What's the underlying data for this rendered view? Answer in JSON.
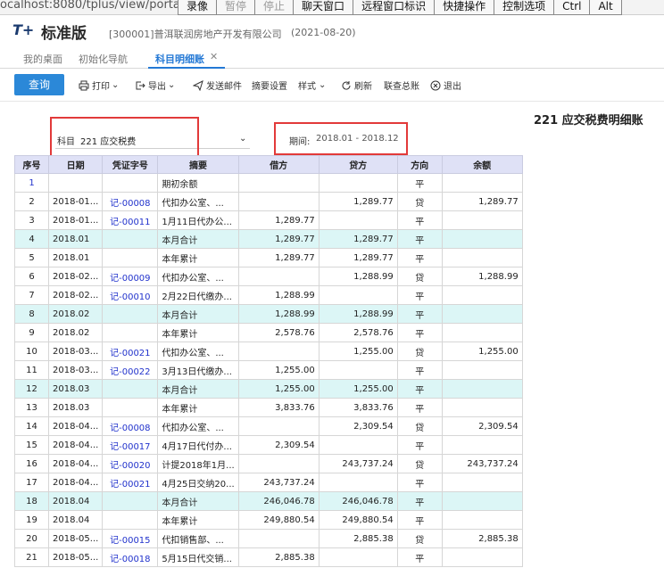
{
  "browser": {
    "url": "ocalhost:8080/tplus/view/portal/pu"
  },
  "remote_toolbar": {
    "items": [
      "录像",
      "暂停",
      "停止",
      "聊天窗口",
      "远程窗口标识",
      "快捷操作",
      "控制选项",
      "Ctrl",
      "Alt"
    ]
  },
  "app": {
    "logo": "T+",
    "product": "标准版",
    "company": "[300001]普洱联润房地产开发有限公司",
    "date": "(2021-08-20)"
  },
  "tabs": [
    {
      "label": "我的桌面"
    },
    {
      "label": "初始化导航"
    },
    {
      "label": "科目明细账"
    }
  ],
  "toolbar": {
    "query": "查询",
    "print": "打印",
    "export": "导出",
    "email": "发送邮件",
    "summary_settings": "摘要设置",
    "style": "样式",
    "refresh": "刷新",
    "link_ledger": "联查总账",
    "exit": "退出"
  },
  "report": {
    "title": "221 应交税费明细账",
    "subject_label": "科目",
    "subject_value": "221 应交税费",
    "period_label": "期间:",
    "period_value": "2018.01 - 2018.12"
  },
  "table": {
    "headers": [
      "序号",
      "日期",
      "凭证字号",
      "摘要",
      "借方",
      "贷方",
      "方向",
      "余额"
    ],
    "rows": [
      {
        "seq": "1",
        "date": "",
        "voucher": "",
        "summary": "期初余额",
        "debit": "",
        "credit": "",
        "dir": "平",
        "balance": "",
        "sum": false
      },
      {
        "seq": "2",
        "date": "2018-01...",
        "voucher": "记-00008",
        "summary": "代扣办公室、...",
        "debit": "",
        "credit": "1,289.77",
        "dir": "贷",
        "balance": "1,289.77",
        "sum": false
      },
      {
        "seq": "3",
        "date": "2018-01...",
        "voucher": "记-00011",
        "summary": "1月11日代办公...",
        "debit": "1,289.77",
        "credit": "",
        "dir": "平",
        "balance": "",
        "sum": false
      },
      {
        "seq": "4",
        "date": "2018.01",
        "voucher": "",
        "summary": "本月合计",
        "debit": "1,289.77",
        "credit": "1,289.77",
        "dir": "平",
        "balance": "",
        "sum": true
      },
      {
        "seq": "5",
        "date": "2018.01",
        "voucher": "",
        "summary": "本年累计",
        "debit": "1,289.77",
        "credit": "1,289.77",
        "dir": "平",
        "balance": "",
        "sum": false
      },
      {
        "seq": "6",
        "date": "2018-02...",
        "voucher": "记-00009",
        "summary": "代扣办公室、...",
        "debit": "",
        "credit": "1,288.99",
        "dir": "贷",
        "balance": "1,288.99",
        "sum": false
      },
      {
        "seq": "7",
        "date": "2018-02...",
        "voucher": "记-00010",
        "summary": "2月22日代缴办...",
        "debit": "1,288.99",
        "credit": "",
        "dir": "平",
        "balance": "",
        "sum": false
      },
      {
        "seq": "8",
        "date": "2018.02",
        "voucher": "",
        "summary": "本月合计",
        "debit": "1,288.99",
        "credit": "1,288.99",
        "dir": "平",
        "balance": "",
        "sum": true
      },
      {
        "seq": "9",
        "date": "2018.02",
        "voucher": "",
        "summary": "本年累计",
        "debit": "2,578.76",
        "credit": "2,578.76",
        "dir": "平",
        "balance": "",
        "sum": false
      },
      {
        "seq": "10",
        "date": "2018-03...",
        "voucher": "记-00021",
        "summary": "代扣办公室、...",
        "debit": "",
        "credit": "1,255.00",
        "dir": "贷",
        "balance": "1,255.00",
        "sum": false
      },
      {
        "seq": "11",
        "date": "2018-03...",
        "voucher": "记-00022",
        "summary": "3月13日代缴办...",
        "debit": "1,255.00",
        "credit": "",
        "dir": "平",
        "balance": "",
        "sum": false
      },
      {
        "seq": "12",
        "date": "2018.03",
        "voucher": "",
        "summary": "本月合计",
        "debit": "1,255.00",
        "credit": "1,255.00",
        "dir": "平",
        "balance": "",
        "sum": true
      },
      {
        "seq": "13",
        "date": "2018.03",
        "voucher": "",
        "summary": "本年累计",
        "debit": "3,833.76",
        "credit": "3,833.76",
        "dir": "平",
        "balance": "",
        "sum": false
      },
      {
        "seq": "14",
        "date": "2018-04...",
        "voucher": "记-00008",
        "summary": "代扣办公室、...",
        "debit": "",
        "credit": "2,309.54",
        "dir": "贷",
        "balance": "2,309.54",
        "sum": false
      },
      {
        "seq": "15",
        "date": "2018-04...",
        "voucher": "记-00017",
        "summary": "4月17日代付办...",
        "debit": "2,309.54",
        "credit": "",
        "dir": "平",
        "balance": "",
        "sum": false
      },
      {
        "seq": "16",
        "date": "2018-04...",
        "voucher": "记-00020",
        "summary": "计提2018年1月...",
        "debit": "",
        "credit": "243,737.24",
        "dir": "贷",
        "balance": "243,737.24",
        "sum": false
      },
      {
        "seq": "17",
        "date": "2018-04...",
        "voucher": "记-00021",
        "summary": "4月25日交纳20...",
        "debit": "243,737.24",
        "credit": "",
        "dir": "平",
        "balance": "",
        "sum": false
      },
      {
        "seq": "18",
        "date": "2018.04",
        "voucher": "",
        "summary": "本月合计",
        "debit": "246,046.78",
        "credit": "246,046.78",
        "dir": "平",
        "balance": "",
        "sum": true
      },
      {
        "seq": "19",
        "date": "2018.04",
        "voucher": "",
        "summary": "本年累计",
        "debit": "249,880.54",
        "credit": "249,880.54",
        "dir": "平",
        "balance": "",
        "sum": false
      },
      {
        "seq": "20",
        "date": "2018-05...",
        "voucher": "记-00015",
        "summary": "代扣销售部、...",
        "debit": "",
        "credit": "2,885.38",
        "dir": "贷",
        "balance": "2,885.38",
        "sum": false
      },
      {
        "seq": "21",
        "date": "2018-05...",
        "voucher": "记-00018",
        "summary": "5月15日代交销...",
        "debit": "2,885.38",
        "credit": "",
        "dir": "平",
        "balance": "",
        "sum": false
      }
    ]
  },
  "colors": {
    "accent": "#2b88d8",
    "header_bg": "#dfe1f6",
    "sum_row_bg": "#dcf6f6",
    "highlight_box": "#e23a3a",
    "voucher_link": "#2233cc"
  }
}
